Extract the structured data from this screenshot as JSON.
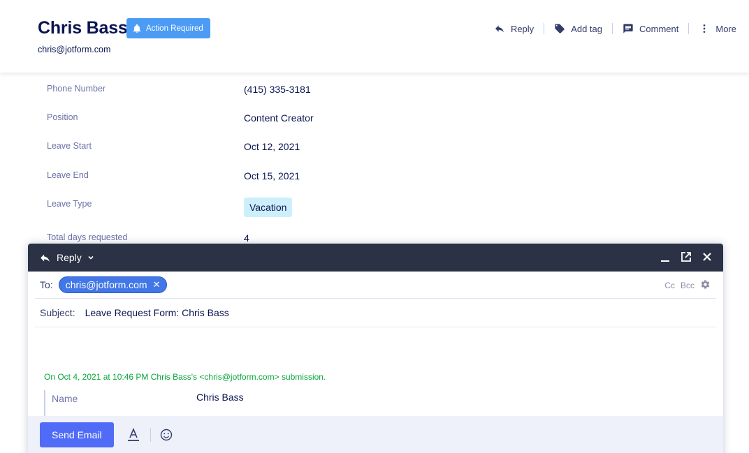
{
  "header": {
    "name": "Chris Bass",
    "badge": "Action Required",
    "email": "chris@jotform.com",
    "actions": {
      "reply": "Reply",
      "add_tag": "Add tag",
      "comment": "Comment",
      "more": "More"
    }
  },
  "fields": [
    {
      "label": "Phone Number",
      "value": "(415) 335-3181"
    },
    {
      "label": "Position",
      "value": "Content Creator"
    },
    {
      "label": "Leave Start",
      "value": "Oct 12, 2021"
    },
    {
      "label": "Leave End",
      "value": "Oct 15, 2021"
    },
    {
      "label": "Leave Type",
      "value": "Vacation"
    },
    {
      "label": "Total days requested",
      "value": "4"
    }
  ],
  "composer": {
    "mode": "Reply",
    "to_label": "To:",
    "to_chip": "chris@jotform.com",
    "cc": "Cc",
    "bcc": "Bcc",
    "subject_label": "Subject:",
    "subject": "Leave Request Form: Chris Bass",
    "quote_header": "On Oct 4, 2021 at 10:46 PM Chris Bass's <chris@jotform.com> submission.",
    "quote_label": "Name",
    "quote_value": "Chris Bass",
    "send": "Send Email"
  },
  "colors": {
    "primary": "#4f6bf7",
    "badge": "#4c9bf5",
    "chip": "#4277e8",
    "composer_bar": "#2b3245",
    "quote_green": "#07a53c",
    "tag_bg": "#cdeffc"
  }
}
